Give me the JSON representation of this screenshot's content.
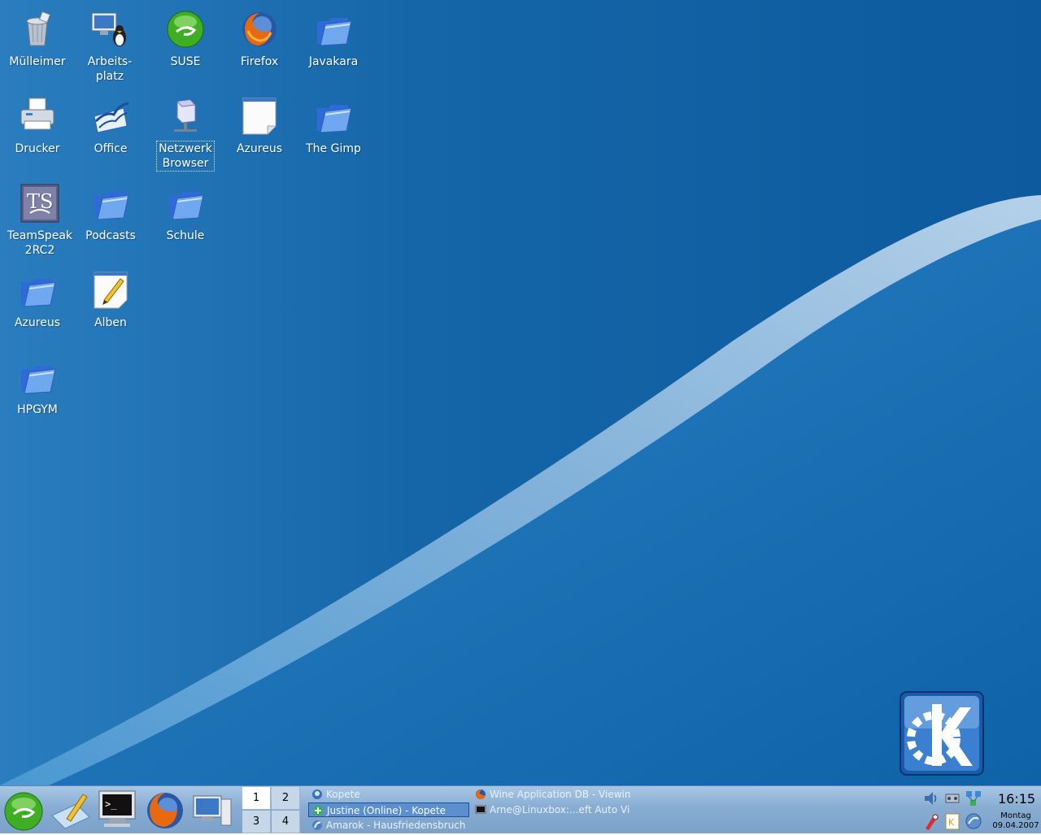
{
  "desktop": {
    "icons": [
      {
        "id": "trash",
        "label": "Mülleimer",
        "icon": "trash-icon"
      },
      {
        "id": "workplace",
        "label": "Arbeits-\nplatz",
        "icon": "computer-tux-icon"
      },
      {
        "id": "suse",
        "label": "SUSE",
        "icon": "suse-icon"
      },
      {
        "id": "firefox",
        "label": "Firefox",
        "icon": "firefox-icon"
      },
      {
        "id": "javakara",
        "label": "Javakara",
        "icon": "folder-icon"
      },
      {
        "id": "printer",
        "label": "Drucker",
        "icon": "printer-icon"
      },
      {
        "id": "office",
        "label": "Office",
        "icon": "office-icon"
      },
      {
        "id": "network",
        "label": "Netzwerk\nBrowser",
        "icon": "network-icon"
      },
      {
        "id": "azureus-file",
        "label": "Azureus",
        "icon": "document-icon"
      },
      {
        "id": "gimp",
        "label": "The Gimp",
        "icon": "folder-icon"
      },
      {
        "id": "teamspeak",
        "label": "TeamSpeak\n2RC2",
        "icon": "teamspeak-icon"
      },
      {
        "id": "podcasts",
        "label": "Podcasts",
        "icon": "folder-icon"
      },
      {
        "id": "schule",
        "label": "Schule",
        "icon": "folder-icon"
      },
      {
        "id": "azureus-folder",
        "label": "Azureus",
        "icon": "folder-icon"
      },
      {
        "id": "alben",
        "label": "Alben",
        "icon": "text-edit-icon"
      },
      {
        "id": "hpgym",
        "label": "HPGYM",
        "icon": "folder-icon"
      }
    ],
    "logo": "kde-logo-icon"
  },
  "panel": {
    "quicklaunch": [
      "suse-menu-icon",
      "kwrite-icon",
      "terminal-icon",
      "firefox-icon",
      "computer-icon"
    ],
    "pager": [
      "1",
      "2",
      "3",
      "4"
    ],
    "pager_active": "1",
    "tasks": [
      {
        "label": "Kopete",
        "icon": "kopete-icon"
      },
      {
        "label": "Justine (Online) - Kopete",
        "icon": "kopete-status-icon",
        "active": true
      },
      {
        "label": "Amarok - Hausfriedensbruch",
        "icon": "amarok-icon"
      },
      {
        "label": "Wine Application DB - Viewin",
        "icon": "firefox-icon"
      },
      {
        "label": "Arne@Linuxbox:...eft Auto Vi",
        "icon": "terminal-icon"
      }
    ],
    "tray": [
      "volume-icon",
      "network-monitor-icon",
      "network-status-icon",
      "klipper-icon",
      "kpdf-icon",
      "update-icon"
    ],
    "clock": {
      "time": "16:15",
      "day": "Montag",
      "date": "09.04.2007"
    }
  }
}
